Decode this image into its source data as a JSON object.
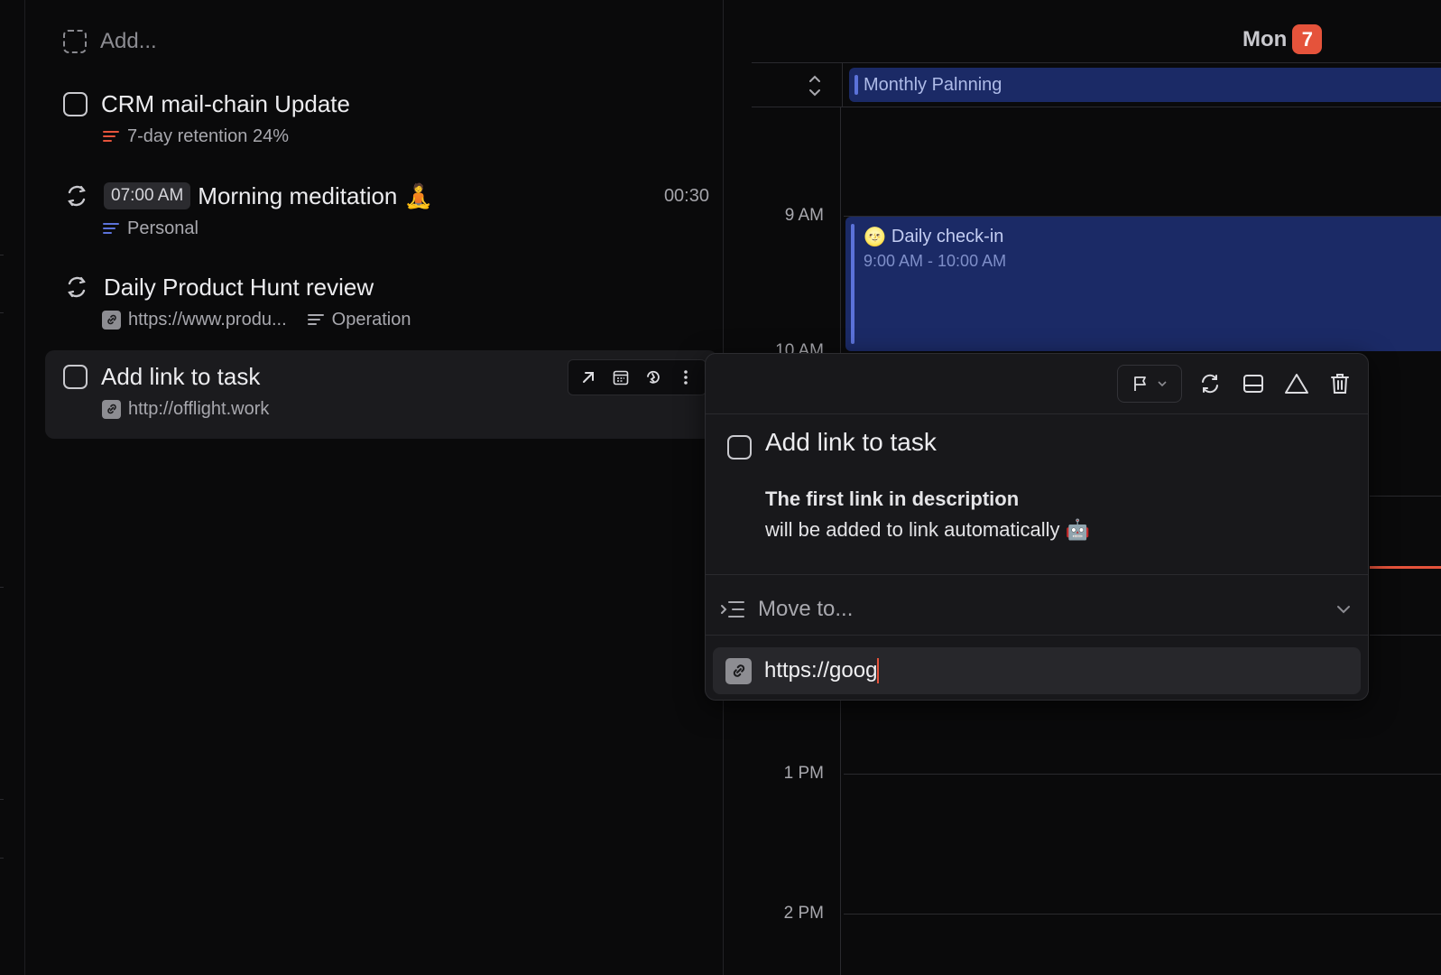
{
  "tasks": {
    "add_placeholder": "Add...",
    "items": [
      {
        "title": "CRM mail-chain Update",
        "meta": [
          {
            "type": "list",
            "label": "7-day retention 24%",
            "color": "#e5533b"
          }
        ]
      },
      {
        "time": "07:00 AM",
        "title": "Morning meditation 🧘",
        "duration": "00:30",
        "meta": [
          {
            "type": "list",
            "label": "Personal",
            "color": "#5b72d9"
          }
        ]
      },
      {
        "title": "Daily Product Hunt review",
        "meta": [
          {
            "type": "link",
            "label": "https://www.produ..."
          },
          {
            "type": "list",
            "label": "Operation",
            "color": "#a8a8ae"
          }
        ]
      },
      {
        "title": "Add link to task",
        "meta": [
          {
            "type": "link",
            "label": "http://offlight.work"
          }
        ]
      }
    ]
  },
  "calendar": {
    "day": "Mon",
    "day_number": "7",
    "allday_event": "Monthly Palnning",
    "hours": [
      "9 AM",
      "10 AM",
      "1 PM",
      "2 PM"
    ],
    "event": {
      "emoji": "🌝",
      "title": "Daily check-in",
      "time": "9:00 AM - 10:00 AM"
    }
  },
  "popover": {
    "title": "Add link to task",
    "description_bold": "The first link in description",
    "description_rest": "will be added to link automatically 🤖",
    "move_to": "Move to...",
    "url_value": "https://goog"
  },
  "colors": {
    "accent": "#e5533b",
    "event_bg": "#1b2a66",
    "event_bar": "#5b72d9"
  }
}
